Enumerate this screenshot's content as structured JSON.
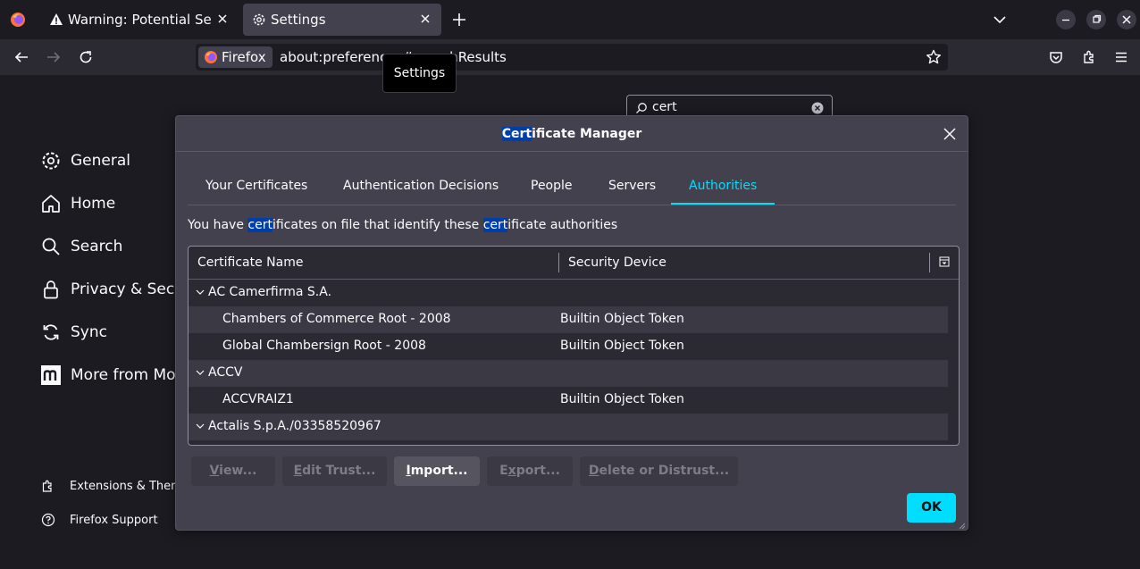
{
  "browser": {
    "tabs": [
      {
        "title": "Warning: Potential Securi",
        "icon": "warning-icon"
      },
      {
        "title": "Settings",
        "icon": "gear-icon"
      }
    ],
    "url": "about:preferences#searchResults",
    "identity_label": "Firefox",
    "tooltip": "Settings"
  },
  "settings": {
    "search_value": "cert",
    "sidebar": [
      {
        "label": "General",
        "icon": "gear-icon"
      },
      {
        "label": "Home",
        "icon": "home-icon"
      },
      {
        "label": "Search",
        "icon": "search-icon"
      },
      {
        "label": "Privacy & Security",
        "icon": "lock-icon"
      },
      {
        "label": "Sync",
        "icon": "sync-icon"
      },
      {
        "label": "More from Mozilla",
        "icon": "mozilla-icon"
      }
    ],
    "footer": [
      {
        "label": "Extensions & Themes",
        "icon": "puzzle-icon"
      },
      {
        "label": "Firefox Support",
        "icon": "help-icon"
      }
    ]
  },
  "dialog": {
    "title_highlight": "Cert",
    "title_rest": "ificate Manager",
    "tabs": [
      "Your Certificates",
      "Authentication Decisions",
      "People",
      "Servers",
      "Authorities"
    ],
    "active_tab": "Authorities",
    "intro": {
      "p1": "You have ",
      "h1": "cert",
      "p2": "ificates on file that identify these ",
      "h2": "cert",
      "p3": "ificate authorities"
    },
    "columns": {
      "name": "Certificate Name",
      "device": "Security Device"
    },
    "groups": [
      {
        "name": "AC Camerfirma S.A.",
        "certs": [
          {
            "name": "Chambers of Commerce Root - 2008",
            "device": "Builtin Object Token"
          },
          {
            "name": "Global Chambersign Root - 2008",
            "device": "Builtin Object Token"
          }
        ]
      },
      {
        "name": "ACCV",
        "certs": [
          {
            "name": "ACCVRAIZ1",
            "device": "Builtin Object Token"
          }
        ]
      },
      {
        "name": "Actalis S.p.A./03358520967",
        "certs": []
      }
    ],
    "buttons": {
      "view": {
        "key": "V",
        "rest": "iew..."
      },
      "edit": {
        "key": "E",
        "rest": "dit Trust..."
      },
      "import": {
        "key": "I",
        "rest": "mport..."
      },
      "export": {
        "pre": "E",
        "key": "x",
        "rest": "port..."
      },
      "delete": {
        "key": "D",
        "rest": "elete or Distrust..."
      }
    },
    "ok_label": "OK"
  },
  "colors": {
    "accent": "#00ddff",
    "highlight": "#003eaa",
    "dialog_bg": "#42414d",
    "page_bg": "#1c1b22"
  }
}
